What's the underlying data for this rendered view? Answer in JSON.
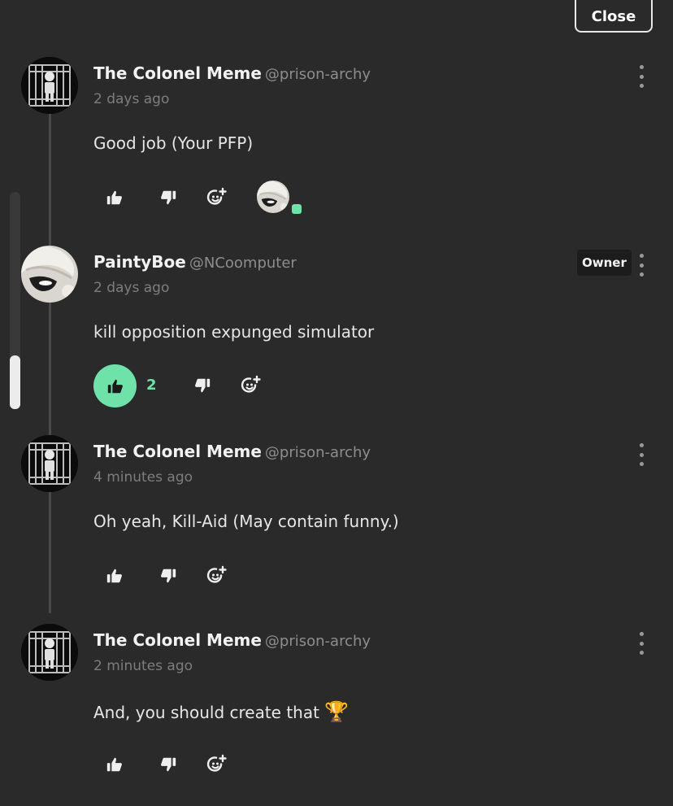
{
  "header": {
    "close_label": "Close"
  },
  "comments": [
    {
      "author": "The Colonel Meme",
      "handle": "@prison-archy",
      "time": "2 days ago",
      "text": "Good job (Your PFP)"
    },
    {
      "author": "PaintyBoe",
      "handle": "@NCoomputer",
      "time": "2 days ago",
      "text": "kill opposition expunged simulator",
      "badge": "Owner",
      "likes": "2"
    },
    {
      "author": "The Colonel Meme",
      "handle": "@prison-archy",
      "time": "4 minutes ago",
      "text": "Oh yeah, Kill-Aid (May contain funny.)"
    },
    {
      "author": "The Colonel Meme",
      "handle": "@prison-archy",
      "time": "2 minutes ago",
      "text": "And, you should create that",
      "emoji": "🏆"
    }
  ],
  "colors": {
    "background": "#2b2a2b",
    "accent": "#6ee2a9",
    "muted_text": "#8e8d8e"
  },
  "icons": [
    "thumbs-up-icon",
    "thumbs-down-icon",
    "add-reaction-icon",
    "more-options-icon"
  ]
}
